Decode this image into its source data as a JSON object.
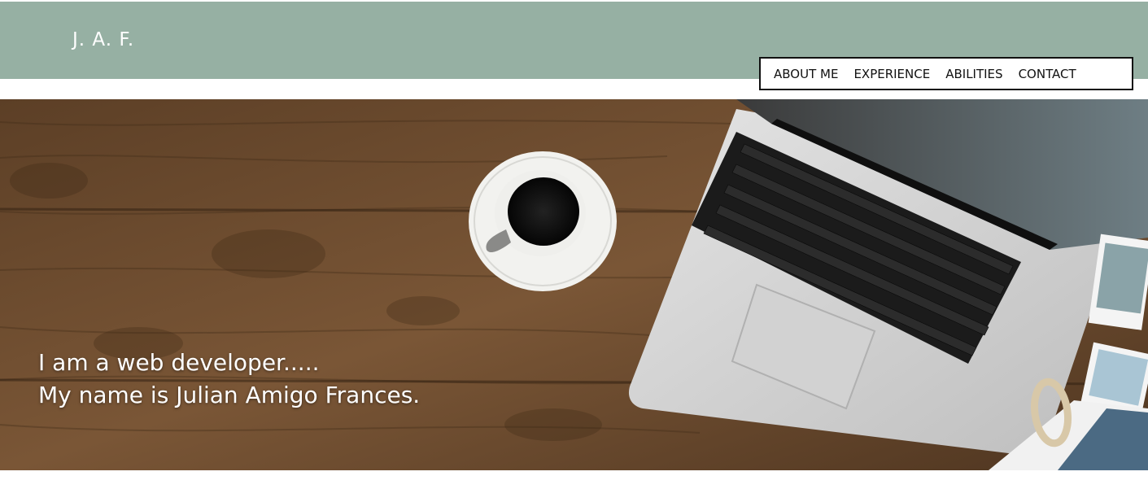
{
  "header": {
    "logo": "J. A. F."
  },
  "nav": {
    "items": [
      {
        "label": "ABOUT ME"
      },
      {
        "label": "EXPERIENCE"
      },
      {
        "label": "ABILITIES"
      },
      {
        "label": "CONTACT"
      }
    ]
  },
  "hero": {
    "line1": "I am a web developer.....",
    "line2": "My name is Julian Amigo Frances."
  },
  "colors": {
    "header_bg": "#96b0a3",
    "nav_border": "#111111",
    "wood": "#6b4a2c"
  }
}
